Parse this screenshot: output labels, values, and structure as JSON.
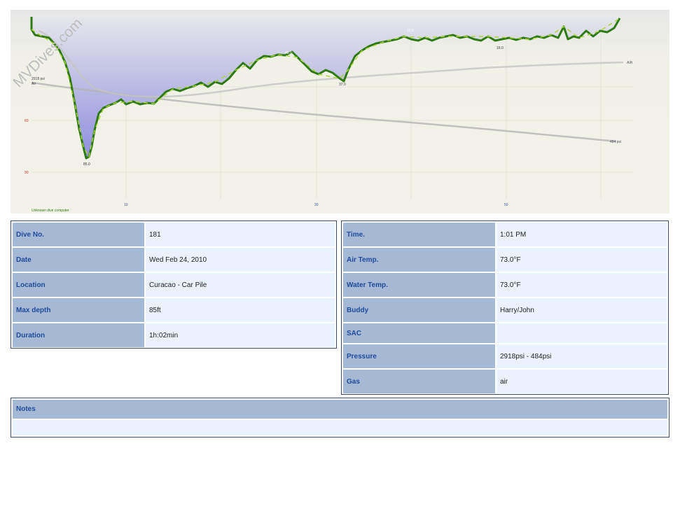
{
  "profile": {
    "watermark": "MVDives.com",
    "computer_label": "Unknown dive computer",
    "air_label": "Air",
    "air_curve_label": "AIR",
    "start_pressure_label": "2918 psi",
    "end_pressure_label": "484 psi",
    "y_ticks": [
      "60",
      "90"
    ],
    "x_ticks": [
      "10",
      "30",
      "50"
    ],
    "depth_labels": [
      "85.0",
      "48.0",
      "37.0",
      "16.0",
      "12.0"
    ]
  },
  "left_table": [
    {
      "label": "Dive No.",
      "value": "181"
    },
    {
      "label": "Date",
      "value": "Wed Feb 24, 2010"
    },
    {
      "label": "Location",
      "value": "Curacao - Car Pile"
    },
    {
      "label": "Max depth",
      "value": "85ft"
    },
    {
      "label": "Duration",
      "value": "1h:02min"
    }
  ],
  "right_table": [
    {
      "label": "Time.",
      "value": "1:01 PM"
    },
    {
      "label": "Air Temp.",
      "value": "73.0°F"
    },
    {
      "label": "Water Temp.",
      "value": "73.0°F"
    },
    {
      "label": "Buddy",
      "value": "Harry/John"
    },
    {
      "label": "SAC",
      "value": ""
    },
    {
      "label": "Pressure",
      "value": "2918psi - 484psi"
    },
    {
      "label": "Gas",
      "value": "air"
    }
  ],
  "notes": {
    "label": "Notes",
    "value": ""
  },
  "colors": {
    "header_cell": "#a5b8d4",
    "value_cell": "#eaf3fd",
    "label_text": "#1f4b9a",
    "border": "#3b4a6b"
  }
}
